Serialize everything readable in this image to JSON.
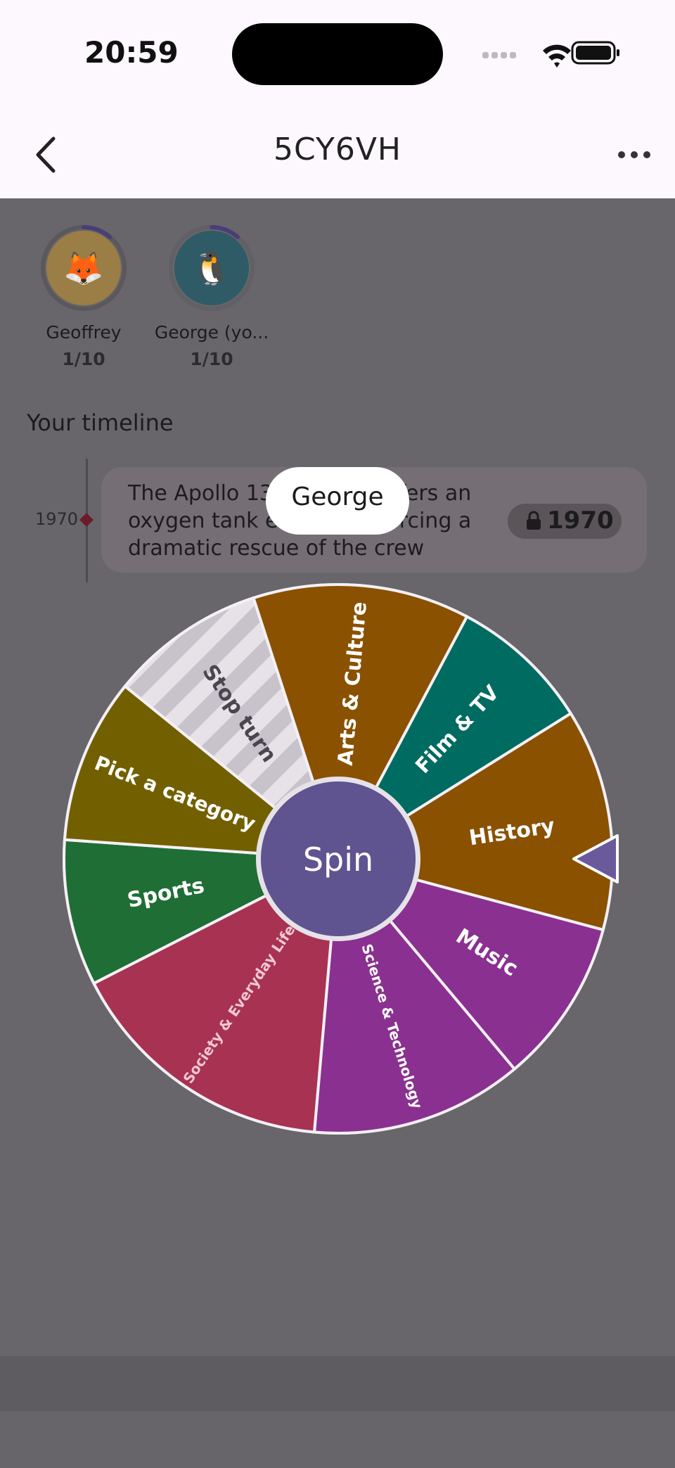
{
  "status": {
    "time": "20:59"
  },
  "nav": {
    "title": "5CY6VH"
  },
  "players": [
    {
      "name": "Geoffrey",
      "score": "1/10",
      "emoji": "🦊",
      "color": "#9a7e45"
    },
    {
      "name": "George (yo...",
      "score": "1/10",
      "emoji": "🐧",
      "color": "#2f5b66"
    }
  ],
  "timeline": {
    "title": "Your timeline",
    "year": "1970",
    "card_text": "The Apollo 13 mission suffers an oxygen tank explosion, forcing a dramatic rescue of the crew",
    "chip_year": "1970"
  },
  "toast": {
    "player": "George"
  },
  "wheel": {
    "center_label": "Spin",
    "segments": [
      {
        "label": "Sports",
        "color": "#1f6e35"
      },
      {
        "label": "Pick a category",
        "color": "#726000"
      },
      {
        "label": "Stop turn",
        "color": "#e3dfe5"
      },
      {
        "label": "Arts & Culture",
        "color": "#8a5100"
      },
      {
        "label": "Film & TV",
        "color": "#006b60"
      },
      {
        "label": "History",
        "color": "#8a5100"
      },
      {
        "label": "Music",
        "color": "#8a3090"
      },
      {
        "label": "Science & Technology",
        "color": "#8a3090"
      },
      {
        "label": "Society & Everyday Life",
        "color": "#a83252"
      }
    ],
    "pointer_color": "#6a5a9c",
    "center_color": "#5f5390"
  }
}
